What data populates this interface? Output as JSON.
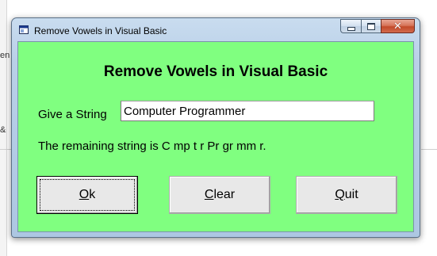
{
  "window": {
    "title": "Remove Vowels in Visual Basic"
  },
  "form": {
    "heading": "Remove Vowels in Visual Basic",
    "input_label": "Give a String",
    "input_value": "Computer Programmer",
    "result_text": "The remaining string is C mp t r Pr gr mm r."
  },
  "buttons": {
    "ok": {
      "mnemonic": "O",
      "rest": "k"
    },
    "clear": {
      "mnemonic": "C",
      "rest": "lear"
    },
    "quit": {
      "mnemonic": "Q",
      "rest": "uit"
    }
  },
  "background": {
    "fragment_top": "en",
    "fragment_mid": "&"
  },
  "colors": {
    "client_bg": "#80ff80",
    "close_button": "#c24a2a"
  },
  "icons": {
    "app": "vb-form-icon",
    "minimize": "minimize-icon",
    "maximize": "maximize-icon",
    "close": "close-icon"
  }
}
